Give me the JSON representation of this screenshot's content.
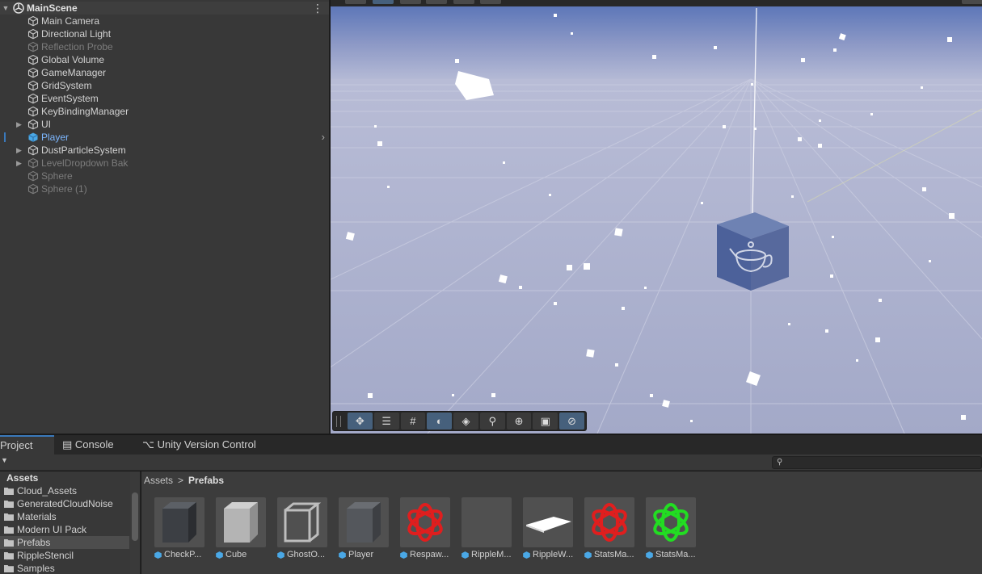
{
  "hierarchy": {
    "scene_name": "MainScene",
    "items": [
      {
        "label": "Main Camera"
      },
      {
        "label": "Directional Light"
      },
      {
        "label": "Reflection Probe"
      },
      {
        "label": "Global Volume"
      },
      {
        "label": "GameManager"
      },
      {
        "label": "GridSystem"
      },
      {
        "label": "EventSystem"
      },
      {
        "label": "KeyBindingManager"
      },
      {
        "label": "UI"
      },
      {
        "label": "Player"
      },
      {
        "label": "DustParticleSystem"
      },
      {
        "label": "LevelDropdown Bak"
      },
      {
        "label": "Sphere"
      },
      {
        "label": "Sphere (1)"
      }
    ],
    "menu_icon": "⋮"
  },
  "scene_toolbar": {
    "buttons": [
      {
        "icon": "move-tool-icon",
        "active": true
      },
      {
        "icon": "settings-sliders-icon",
        "active": false
      },
      {
        "icon": "grid-icon",
        "active": false
      },
      {
        "icon": "lighting-icon",
        "active": true
      },
      {
        "icon": "layers-icon",
        "active": false
      },
      {
        "icon": "search-icon",
        "active": false
      },
      {
        "icon": "gizmo-icon",
        "active": false
      },
      {
        "icon": "camera-icon",
        "active": false
      },
      {
        "icon": "compass-icon",
        "active": true
      }
    ]
  },
  "bottom_tabs": {
    "project": "Project",
    "console": "Console",
    "version_control": "Unity Version Control"
  },
  "project_tree": {
    "root": "Assets",
    "folders": [
      {
        "label": "Cloud_Assets"
      },
      {
        "label": "GeneratedCloudNoise"
      },
      {
        "label": "Materials"
      },
      {
        "label": "Modern UI Pack"
      },
      {
        "label": "Prefabs"
      },
      {
        "label": "RippleStencil"
      },
      {
        "label": "Samples"
      }
    ]
  },
  "breadcrumb": {
    "root": "Assets",
    "separator": ">",
    "current": "Prefabs"
  },
  "assets": [
    {
      "name": "CheckP...",
      "thumb": "dark-cube"
    },
    {
      "name": "Cube",
      "thumb": "light-cube"
    },
    {
      "name": "GhostO...",
      "thumb": "wire-cube"
    },
    {
      "name": "Player",
      "thumb": "grey-cube"
    },
    {
      "name": "Respaw...",
      "thumb": "red-knot"
    },
    {
      "name": "RippleM...",
      "thumb": "empty"
    },
    {
      "name": "RippleW...",
      "thumb": "white-plane"
    },
    {
      "name": "StatsMa...",
      "thumb": "red-knot"
    },
    {
      "name": "StatsMa...",
      "thumb": "green-knot"
    }
  ],
  "colors": {
    "accent": "#3a79bb",
    "selected_text": "#7db7ff",
    "sky": "#5571b6",
    "floor": "#a7adcc"
  }
}
